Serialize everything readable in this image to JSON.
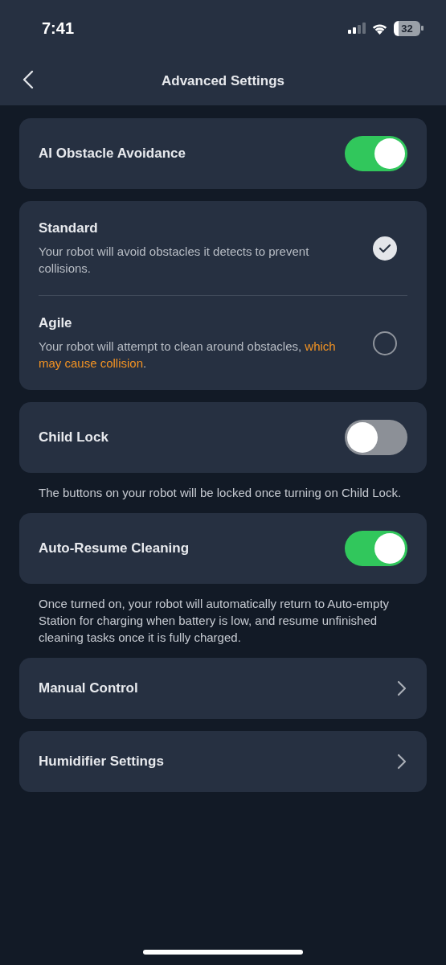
{
  "status_bar": {
    "time": "7:41",
    "battery": "32"
  },
  "nav": {
    "title": "Advanced Settings"
  },
  "sections": [
    {
      "kind": "toggle",
      "label": "AI Obstacle Avoidance",
      "on": true
    },
    {
      "kind": "radio-group",
      "options": [
        {
          "label": "Standard",
          "description": "Your robot will avoid obstacles it detects to prevent collisions.",
          "selected": true
        },
        {
          "label": "Agile",
          "description": "Your robot will attempt to clean around obstacles,",
          "warning": "which may cause collision",
          "description_end": ".",
          "selected": false
        }
      ]
    },
    {
      "kind": "toggle",
      "label": "Child Lock",
      "on": false,
      "note": "The buttons on your robot will be locked once turning on Child Lock."
    },
    {
      "kind": "toggle",
      "label": "Auto-Resume Cleaning",
      "on": true,
      "note": "Once turned on, your robot will automatically return to Auto-empty Station for charging when battery is low, and resume unfinished cleaning tasks once it is fully charged."
    },
    {
      "kind": "link",
      "label": "Manual Control"
    },
    {
      "kind": "link",
      "label": "Humidifier Settings"
    }
  ]
}
